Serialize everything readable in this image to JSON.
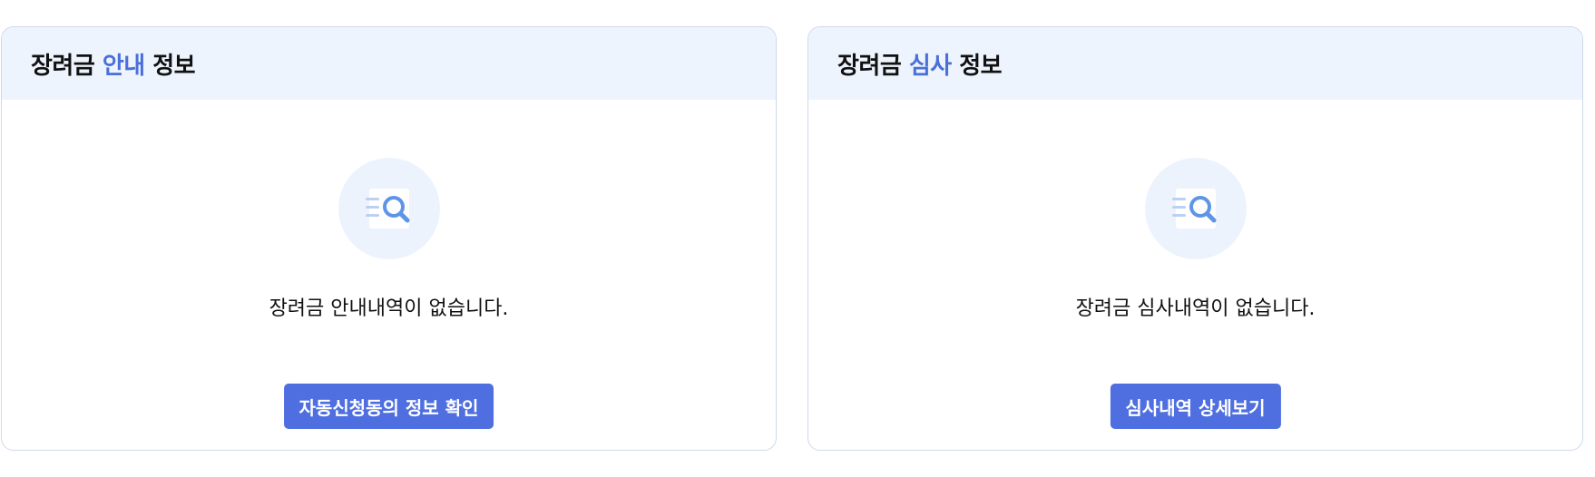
{
  "cards": [
    {
      "title_prefix": "장려금 ",
      "title_accent": "안내",
      "title_suffix": " 정보",
      "empty_message": "장려금 안내내역이 없습니다.",
      "button_label": "자동신청동의 정보 확인",
      "icon": "document-search-icon"
    },
    {
      "title_prefix": "장려금 ",
      "title_accent": "심사",
      "title_suffix": " 정보",
      "empty_message": "장려금 심사내역이 없습니다.",
      "button_label": "심사내역 상세보기",
      "icon": "document-search-icon"
    }
  ],
  "colors": {
    "accent": "#4a6fd8",
    "button": "#4f6fe0",
    "header_bg": "#eef4fd",
    "border": "#cfd9ea"
  }
}
